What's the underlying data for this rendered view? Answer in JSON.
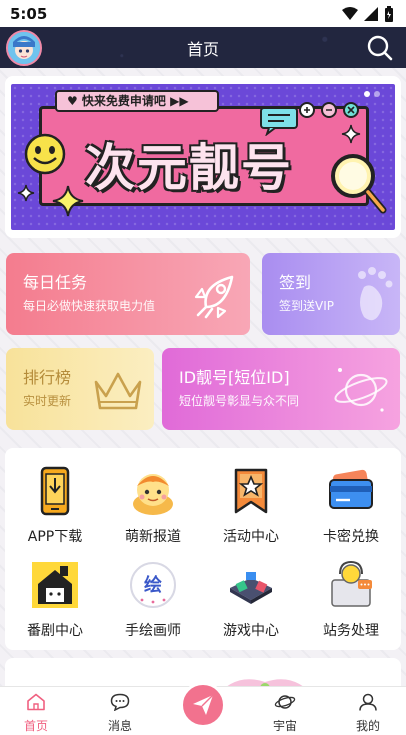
{
  "status_bar": {
    "time": "5:05"
  },
  "header": {
    "title": "首页"
  },
  "banner": {
    "tag": "♥ 快来免费申请吧 ▶▶",
    "title": "次元靓号"
  },
  "tiles": {
    "daily": {
      "title": "每日任务",
      "subtitle": "每日必做快速获取电力值"
    },
    "signin": {
      "title": "签到",
      "subtitle": "签到送VIP"
    },
    "ranking": {
      "title": "排行榜",
      "subtitle": "实时更新"
    },
    "id": {
      "title": "ID靓号[短位ID]",
      "subtitle": "短位靓号彰显与众不同"
    }
  },
  "grid": {
    "items": [
      {
        "label": "APP下载",
        "icon": "phone-icon"
      },
      {
        "label": "萌新报道",
        "icon": "mascot-icon"
      },
      {
        "label": "活动中心",
        "icon": "star-bookmark-icon"
      },
      {
        "label": "卡密兑换",
        "icon": "card-icon"
      },
      {
        "label": "番剧中心",
        "icon": "tv-house-icon"
      },
      {
        "label": "手绘画师",
        "icon": "draw-badge-icon"
      },
      {
        "label": "游戏中心",
        "icon": "gamepad-icon"
      },
      {
        "label": "站务处理",
        "icon": "support-icon"
      }
    ],
    "draw_badge_text": "绘"
  },
  "tabbar": {
    "items": [
      {
        "label": "首页",
        "active": true
      },
      {
        "label": "消息",
        "active": false
      },
      {
        "label": "宇宙",
        "active": false
      },
      {
        "label": "我的",
        "active": false
      }
    ]
  },
  "colors": {
    "accent": "#f06080",
    "header_bg": "#22263f",
    "banner_bg": "#6b48d8"
  }
}
